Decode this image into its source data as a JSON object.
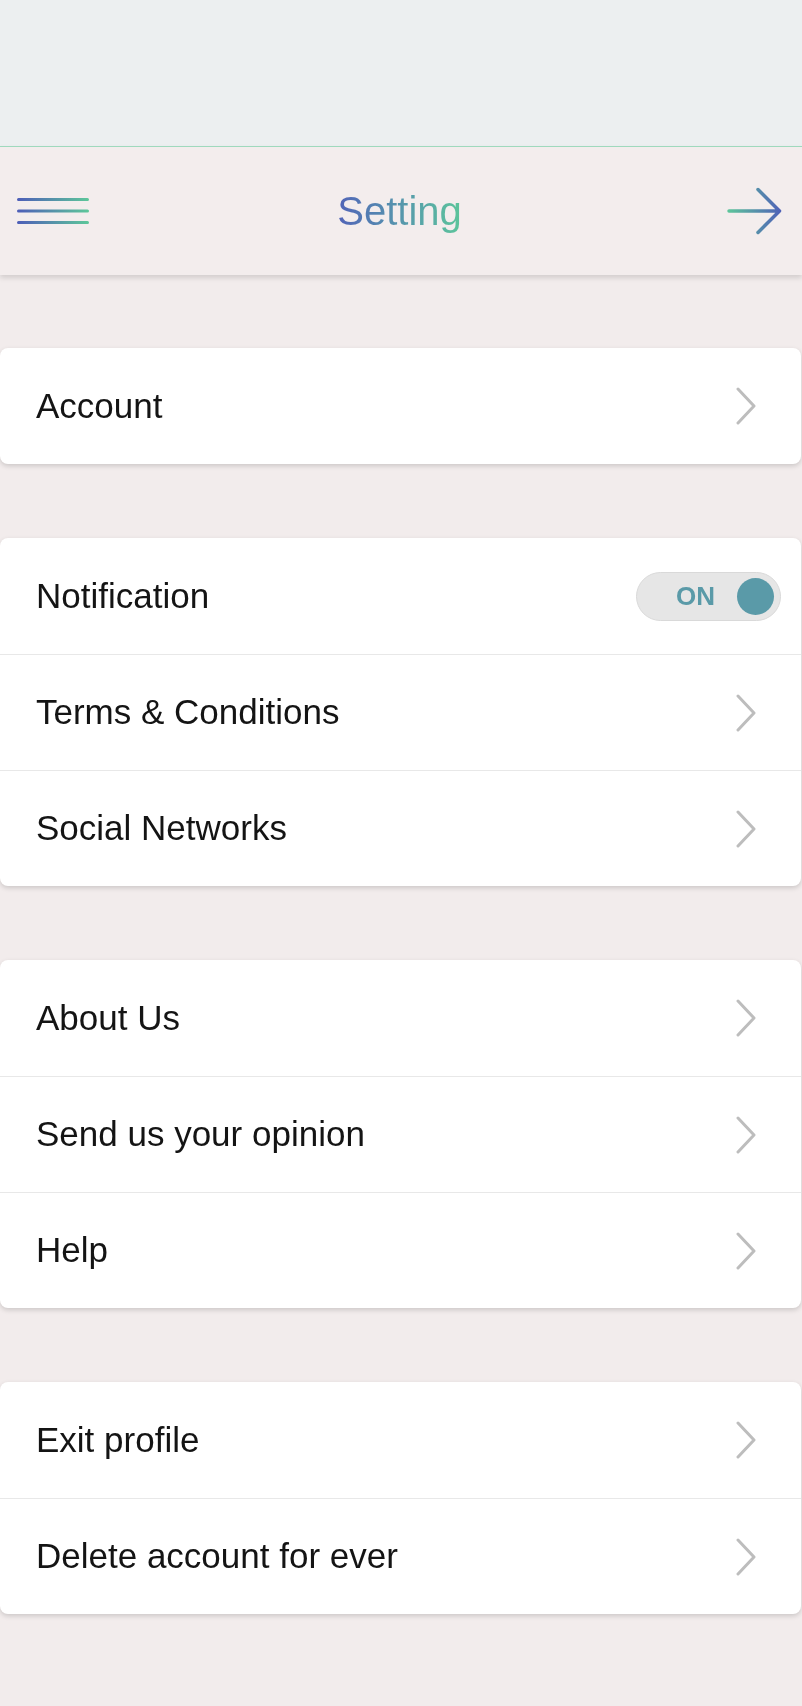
{
  "header": {
    "title": "Setting"
  },
  "groups": [
    {
      "items": [
        {
          "kind": "link",
          "label": "Account"
        }
      ]
    },
    {
      "items": [
        {
          "kind": "toggle",
          "label": "Notification",
          "on": true,
          "state_label": "ON"
        },
        {
          "kind": "link",
          "label": "Terms & Conditions"
        },
        {
          "kind": "link",
          "label": "Social Networks"
        }
      ]
    },
    {
      "items": [
        {
          "kind": "link",
          "label": "About Us"
        },
        {
          "kind": "link",
          "label": "Send us your opinion"
        },
        {
          "kind": "link",
          "label": "Help"
        }
      ]
    },
    {
      "items": [
        {
          "kind": "link",
          "label": "Exit profile"
        },
        {
          "kind": "link",
          "label": "Delete account for ever"
        }
      ]
    }
  ]
}
